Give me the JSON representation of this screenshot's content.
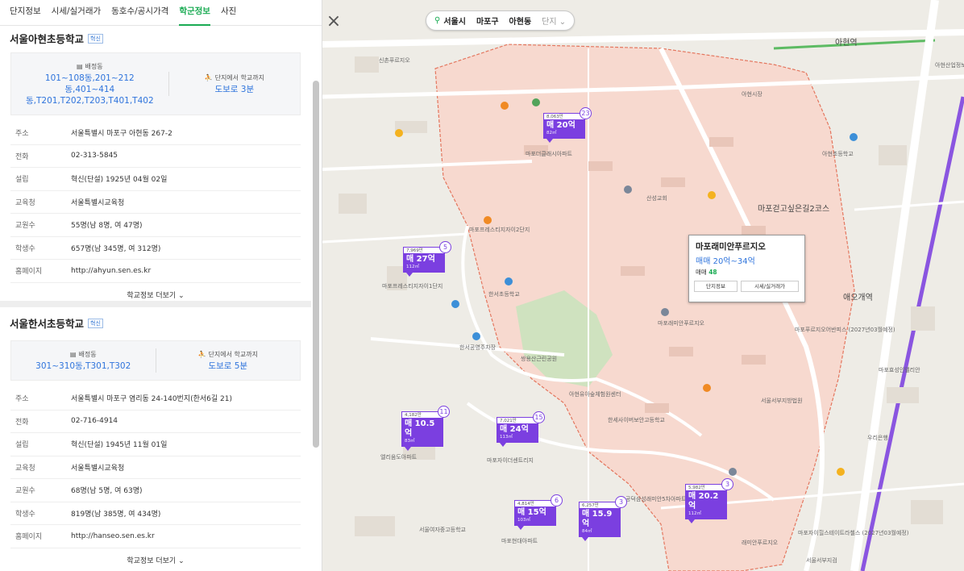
{
  "tabs": [
    "단지정보",
    "시세/실거래가",
    "동호수/공시가격",
    "학군정보",
    "사진"
  ],
  "active_tab": "학군정보",
  "schools": [
    {
      "name": "서울아현초등학교",
      "badge": "혁신",
      "assign_label": "배정동",
      "assign_value": "101~108동,201~212동,401~414동,T201,T202,T203,T401,T402",
      "walk_label": "단지에서 학교까지",
      "walk_value": "도보로 3분",
      "rows": [
        {
          "k": "주소",
          "v": "서울특별시 마포구 아현동 267-2"
        },
        {
          "k": "전화",
          "v": "02-313-5845"
        },
        {
          "k": "설립",
          "v": "혁신(단설) 1925년 04월 02일"
        },
        {
          "k": "교육청",
          "v": "서울특별시교육청"
        },
        {
          "k": "교원수",
          "v": "55명(남 8명, 여 47명)"
        },
        {
          "k": "학생수",
          "v": "657명(남 345명, 여 312명)"
        },
        {
          "k": "홈페이지",
          "v": "http://ahyun.sen.es.kr"
        }
      ],
      "more": "학교정보 더보기"
    },
    {
      "name": "서울한서초등학교",
      "badge": "혁신",
      "assign_label": "배정동",
      "assign_value": "301~310동,T301,T302",
      "walk_label": "단지에서 학교까지",
      "walk_value": "도보로 5분",
      "rows": [
        {
          "k": "주소",
          "v": "서울특별시 마포구 염리동 24-140번지(한서6길 21)"
        },
        {
          "k": "전화",
          "v": "02-716-4914"
        },
        {
          "k": "설립",
          "v": "혁신(단설) 1945년 11월 01일"
        },
        {
          "k": "교육청",
          "v": "서울특별시교육청"
        },
        {
          "k": "교원수",
          "v": "68명(남 5명, 여 63명)"
        },
        {
          "k": "학생수",
          "v": "819명(남 385명, 여 434명)"
        },
        {
          "k": "홈페이지",
          "v": "http://hanseo.sen.es.kr"
        }
      ],
      "more": "학교정보 더보기"
    }
  ],
  "location": {
    "city": "서울시",
    "district": "마포구",
    "dong": "아현동",
    "filter": "단지"
  },
  "markers": [
    {
      "top": "8,063만",
      "price": "매 20억",
      "area": "82㎡",
      "count": "23"
    },
    {
      "top": "7,969만",
      "price": "매 27억",
      "area": "112㎡",
      "count": "5"
    },
    {
      "top": "4,182만",
      "price": "매 10.5억",
      "area": "83㎡",
      "count": "11"
    },
    {
      "top": "7,021만",
      "price": "매 24억",
      "area": "113㎡",
      "count": "15"
    },
    {
      "top": "4,814만",
      "price": "매 15억",
      "area": "103㎡",
      "count": "6"
    },
    {
      "top": "6,257만",
      "price": "매 15.9억",
      "area": "84㎡",
      "count": "3"
    },
    {
      "top": "5,982만",
      "price": "매 20.2억",
      "area": "112㎡",
      "count": "3"
    }
  ],
  "popup": {
    "title": "마포래미안푸르지오",
    "price": "매매 20억~34억",
    "count_label": "매매",
    "count": "48",
    "btn1": "단지정보",
    "btn2": "시세/실거래가"
  },
  "map_labels": [
    "아현역",
    "애오개역",
    "마포프레스티지자이2단지",
    "마포프레스티지자이1단지",
    "한서초등학교",
    "아현초등학교",
    "마포래미안푸르지오",
    "산성교회",
    "마포걷고싶은길2코스",
    "마포더클래시아파트",
    "신촌푸르지오",
    "아현산업정보학교",
    "한서공영주차장",
    "쌍용산근린공원",
    "아현유아숲체험원센터",
    "서울서부지방법원",
    "공덕삼성래미안5차아파트",
    "마포현대아파트",
    "한세사이버보안고등학교",
    "마포자이더센트리지",
    "서울여자중고등학교",
    "우리은행",
    "아현시장",
    "마포푸르지오어반피스 (2027년03월예정)",
    "마포자이힐스테이트라첼스 (2027년03월예정)",
    "서울서부지검",
    "마포효성인텔리안",
    "래미안푸르지오",
    "엘리움도아파트"
  ]
}
